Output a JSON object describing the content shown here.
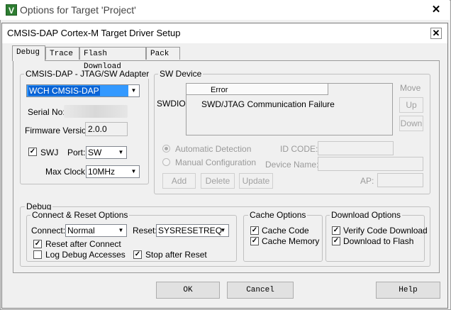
{
  "outer_window": {
    "title": "Options for Target 'Project'",
    "app_icon": "V"
  },
  "dialog": {
    "title": "CMSIS-DAP Cortex-M Target Driver Setup"
  },
  "tabs": [
    {
      "label": "Debug",
      "active": true
    },
    {
      "label": "Trace",
      "active": false
    },
    {
      "label": "Flash Download",
      "active": false
    },
    {
      "label": "Pack",
      "active": false
    }
  ],
  "adapter": {
    "group_label": "CMSIS-DAP - JTAG/SW Adapter",
    "selected": "WCH CMSIS-DAP",
    "serial_label": "Serial No:",
    "firmware_label": "Firmware Version:",
    "firmware_value": "2.0.0",
    "swj_label": "SWJ",
    "swj_checked": true,
    "port_label": "Port:",
    "port_value": "SW",
    "maxclock_label": "Max Clock:",
    "maxclock_value": "10MHz"
  },
  "sw_device": {
    "group_label": "SW Device",
    "swdio_label": "SWDIO",
    "table_header": "Error",
    "table_row": "SWD/JTAG Communication Failure",
    "move_label": "Move",
    "up_label": "Up",
    "down_label": "Down",
    "auto_detect_label": "Automatic Detection",
    "manual_config_label": "Manual Configuration",
    "id_code_label": "ID CODE:",
    "device_name_label": "Device Name:",
    "add_label": "Add",
    "delete_label": "Delete",
    "update_label": "Update",
    "ap_label": "AP:"
  },
  "debug": {
    "group_label": "Debug",
    "connect_reset_label": "Connect & Reset Options",
    "connect_label": "Connect:",
    "connect_value": "Normal",
    "reset_label": "Reset:",
    "reset_value": "SYSRESETREQ",
    "reset_after_connect": "Reset after Connect",
    "log_debug": "Log Debug Accesses",
    "stop_after_reset": "Stop after Reset",
    "cache_options_label": "Cache Options",
    "cache_code": "Cache Code",
    "cache_memory": "Cache Memory",
    "download_options_label": "Download Options",
    "verify_code_download": "Verify Code Download",
    "download_to_flash": "Download to Flash"
  },
  "buttons": {
    "ok": "OK",
    "cancel": "Cancel",
    "help": "Help"
  }
}
